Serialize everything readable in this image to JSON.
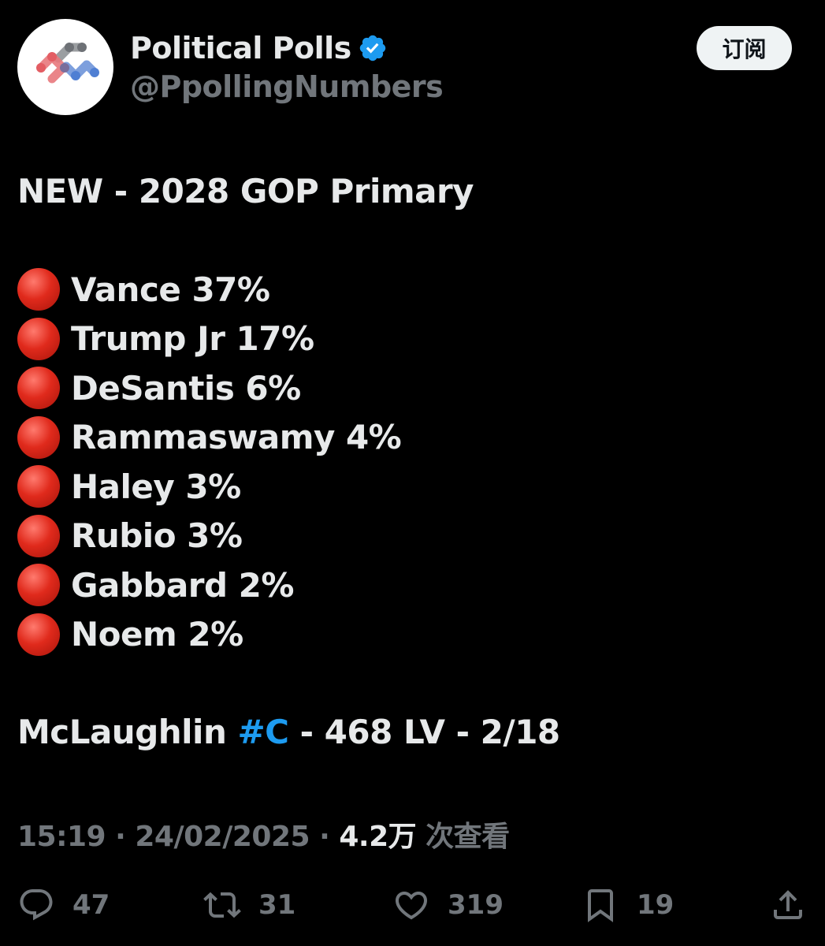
{
  "account": {
    "display_name": "Political Polls",
    "handle": "@PpollingNumbers",
    "verified": true
  },
  "subscribe_label": "订阅",
  "tweet": {
    "headline": "NEW - 2028 GOP Primary",
    "poll_results": [
      {
        "text": "Vance 37%",
        "candidate": "Vance",
        "percent": 37
      },
      {
        "text": "Trump Jr 17%",
        "candidate": "Trump Jr",
        "percent": 17
      },
      {
        "text": "DeSantis 6%",
        "candidate": "DeSantis",
        "percent": 6
      },
      {
        "text": "Rammaswamy 4%",
        "candidate": "Rammaswamy",
        "percent": 4
      },
      {
        "text": "Haley 3%",
        "candidate": "Haley",
        "percent": 3
      },
      {
        "text": "Rubio 3%",
        "candidate": "Rubio",
        "percent": 3
      },
      {
        "text": "Gabbard 2%",
        "candidate": "Gabbard",
        "percent": 2
      },
      {
        "text": "Noem 2%",
        "candidate": "Noem",
        "percent": 2
      }
    ],
    "bullet_icon": "red-circle-icon",
    "source_prefix": "McLaughlin ",
    "source_hashtag": "#C",
    "source_suffix": " - 468 LV - 2/18"
  },
  "meta": {
    "time": "15:19",
    "separator": "·",
    "date": "24/02/2025",
    "views_count": "4.2万",
    "views_label": "次查看"
  },
  "actions": {
    "replies": "47",
    "retweets": "31",
    "likes": "319",
    "bookmarks": "19"
  },
  "colors": {
    "background": "#000000",
    "text_primary": "#e7e9ea",
    "text_secondary": "#71767b",
    "accent": "#1d9bf0",
    "bullet": "#e02a1c",
    "button_bg": "#eff3f4"
  }
}
